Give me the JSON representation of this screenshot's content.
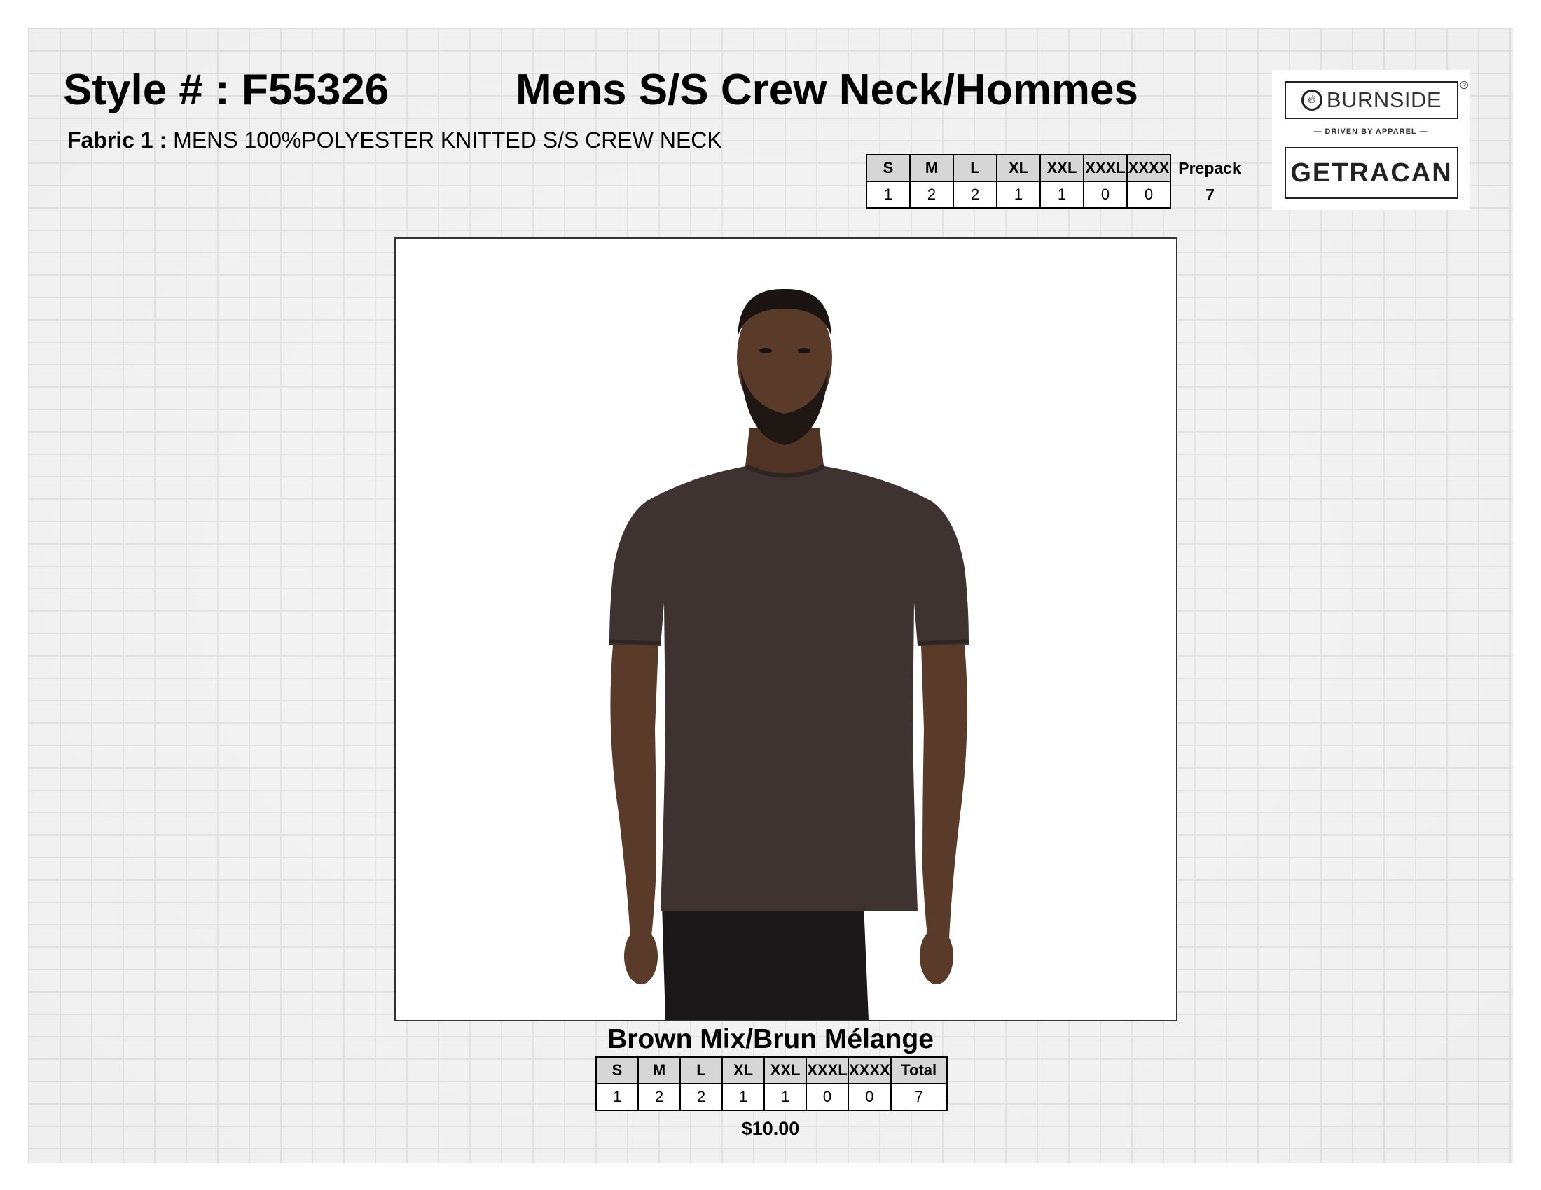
{
  "header": {
    "style_number": "Style # : F55326",
    "title": "Mens S/S Crew Neck/Hommes",
    "fabric_label": "Fabric 1 :",
    "fabric_value": "MENS 100%POLYESTER KNITTED S/S CREW NECK"
  },
  "prepack": {
    "sizes": [
      "S",
      "M",
      "L",
      "XL",
      "XXL",
      "XXXL",
      "XXXX"
    ],
    "quantities": [
      "1",
      "2",
      "2",
      "1",
      "1",
      "0",
      "0"
    ],
    "label": "Prepack",
    "total": "7"
  },
  "logos": {
    "burnside": "BURNSIDE",
    "registered": "®",
    "tagline": "— DRIVEN BY APPAREL —",
    "getracan": "GETRACAN"
  },
  "product_image": {
    "description_icon": "product-photo",
    "shirt_color": "#3e3331"
  },
  "color_block": {
    "color_name": "Brown Mix/Brun Mélange",
    "sizes": [
      "S",
      "M",
      "L",
      "XL",
      "XXL",
      "XXXL",
      "XXXX"
    ],
    "total_label": "Total",
    "quantities": [
      "1",
      "2",
      "2",
      "1",
      "1",
      "0",
      "0"
    ],
    "total": "7",
    "price": "$10.00"
  }
}
